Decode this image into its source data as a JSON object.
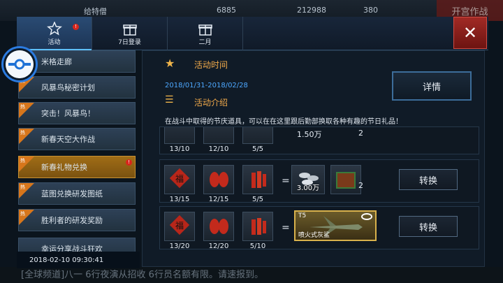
{
  "hud": {
    "player_name": "给特僧",
    "stat1": "6885",
    "stat2": "212988",
    "stat3": "380",
    "red_button": "开宫作战",
    "chat_text": "[全球频道]八一 6行夜演从招收 6行员名额有限。请速报到。"
  },
  "tabs": [
    {
      "label": "活动",
      "active": true,
      "badge": "!"
    },
    {
      "label": "7日登录",
      "active": false
    },
    {
      "label": "二月",
      "active": false
    }
  ],
  "close_label": "✕",
  "sidebar": {
    "items": [
      {
        "label": "米格走廊",
        "hot": false,
        "active": false
      },
      {
        "label": "风暴鸟秘密计划",
        "hot": true,
        "active": false
      },
      {
        "label": "突击！风暴鸟！",
        "hot": true,
        "active": false
      },
      {
        "label": "新春天空大作战",
        "hot": true,
        "active": false
      },
      {
        "label": "新春礼物兑换",
        "hot": true,
        "active": true,
        "badge": "!"
      },
      {
        "label": "蓝图兑换研发图纸",
        "hot": true,
        "active": false
      },
      {
        "label": "胜利者的研发奖励",
        "hot": true,
        "active": false
      },
      {
        "label": "幸运分享战斗狂欢",
        "hot": false,
        "active": false
      }
    ],
    "hot_label": "热"
  },
  "datetime": "2018-02-10 09:30:41",
  "main": {
    "time_title": "活动时间",
    "date_range": "2018/01/31-2018/02/28",
    "intro_title": "活动介绍",
    "description": "在战斗中取得的节庆道具，可以在在这里跟后勤部换取各种有趣的节日礼品！",
    "detail_button": "详情",
    "convert_label": "转换",
    "rows": [
      {
        "items": [
          "13/10",
          "12/10",
          "5/5"
        ],
        "reward_amount": "1.50万",
        "reward_count": "2"
      },
      {
        "items": [
          "13/15",
          "12/15",
          "5/5"
        ],
        "reward_amount": "3.00万",
        "reward_count": "2"
      },
      {
        "items": [
          "13/20",
          "12/20",
          "5/10"
        ],
        "plane_tier": "T5",
        "plane_name": "喷火式灰鲨"
      }
    ]
  },
  "colors": {
    "accent": "#f0a94a",
    "date": "#4da8ff",
    "active_item": "#a06d16",
    "close": "#a12a25"
  }
}
